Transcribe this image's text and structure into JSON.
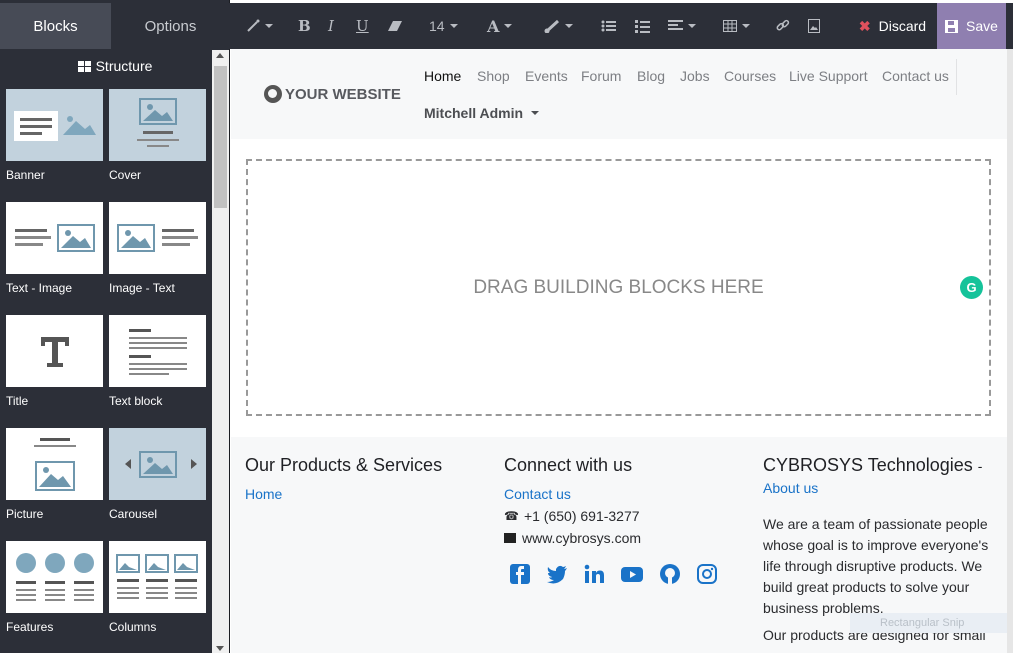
{
  "sidebar": {
    "tabs": [
      "Blocks",
      "Options"
    ],
    "section_title": "Structure",
    "snippets": [
      "Banner",
      "Cover",
      "Text - Image",
      "Image - Text",
      "Title",
      "Text block",
      "Picture",
      "Carousel",
      "Features",
      "Columns"
    ]
  },
  "toolbar": {
    "font_size": "14",
    "discard_label": "Discard",
    "save_label": "Save"
  },
  "header": {
    "logo_text": "YOUR WEBSITE",
    "nav": [
      "Home",
      "Shop",
      "Events",
      "Forum",
      "Blog",
      "Jobs",
      "Courses",
      "Live Support",
      "Contact us"
    ],
    "active_nav": "Home",
    "user": "Mitchell Admin"
  },
  "main": {
    "dropzone_text": "DRAG BUILDING BLOCKS HERE"
  },
  "footer": {
    "col1": {
      "title": "Our Products & Services",
      "link": "Home"
    },
    "col2": {
      "title": "Connect with us",
      "link": "Contact us",
      "phone": "+1 (650) 691-3277",
      "email": "www.cybrosys.com"
    },
    "col3": {
      "title": "CYBROSYS Technologies",
      "dash": "-",
      "link": "About us",
      "text": "We are a team of passionate people whose goal is to improve everyone's life through disruptive products. We build great products to solve your business problems.",
      "text2": "Our products are designed for small"
    }
  },
  "overlay": {
    "snip_tool": "Rectangular Snip"
  },
  "colors": {
    "accent": "#8f7fb0",
    "link": "#1a73c8",
    "sidebar": "#2c2f38",
    "discard_x": "#e0515d"
  }
}
